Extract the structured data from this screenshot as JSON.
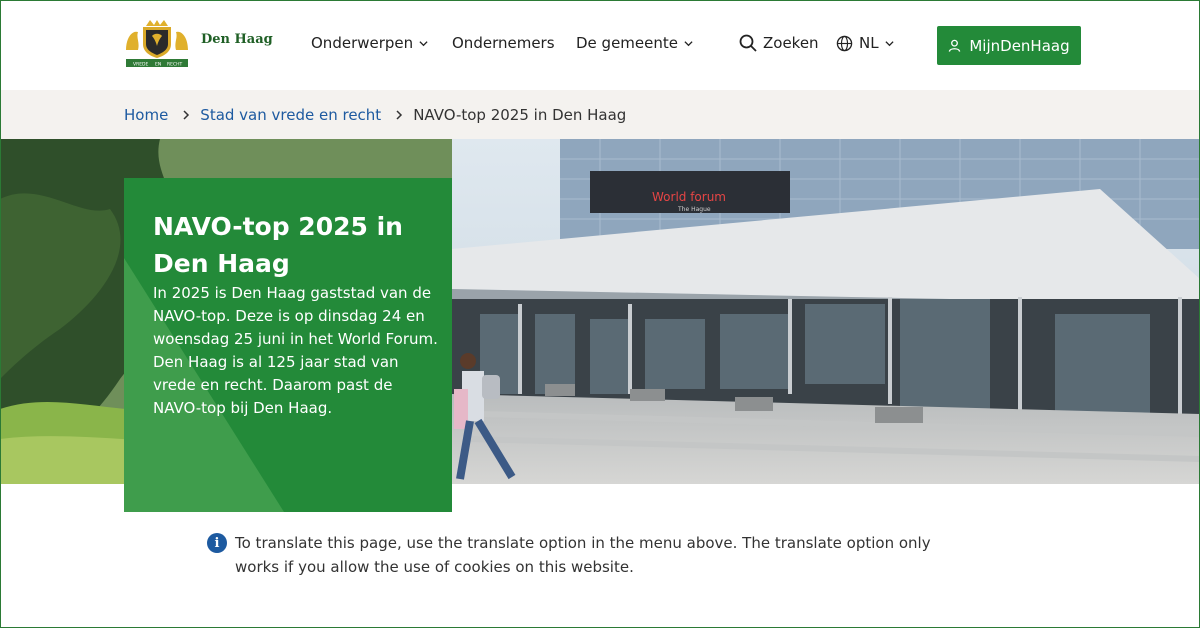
{
  "header": {
    "logo_text": "Den Haag",
    "logo_motto_left": "VREDE",
    "logo_motto_mid": "EN",
    "logo_motto_right": "RECHT",
    "nav": {
      "onderwerpen": "Onderwerpen",
      "ondernemers": "Ondernemers",
      "gemeente": "De gemeente",
      "zoeken": "Zoeken",
      "language": "NL"
    },
    "account_button": "MijnDenHaag"
  },
  "breadcrumb": {
    "items": [
      "Home",
      "Stad van vrede en recht"
    ],
    "current": "NAVO-top 2025 in Den Haag"
  },
  "hero": {
    "title": "NAVO-top 2025 in Den Haag",
    "text": "In 2025 is Den Haag gaststad van de NAVO-top. Deze is op dinsdag 24 en woensdag 25 juni in het World Forum. Den Haag is al 125 jaar stad van vrede en recht. Daarom past de NAVO-top bij Den Haag.",
    "building_sign": "World forum",
    "building_sign_sub": "The Hague"
  },
  "notice": {
    "icon": "info-icon",
    "text": "To translate this page, use the translate option in the menu above. The translate option only works if you allow the use of cookies on this website."
  },
  "colors": {
    "brand_green": "#238a39",
    "link_blue": "#1d5aa0",
    "breadcrumb_bg": "#f4f2ef"
  }
}
